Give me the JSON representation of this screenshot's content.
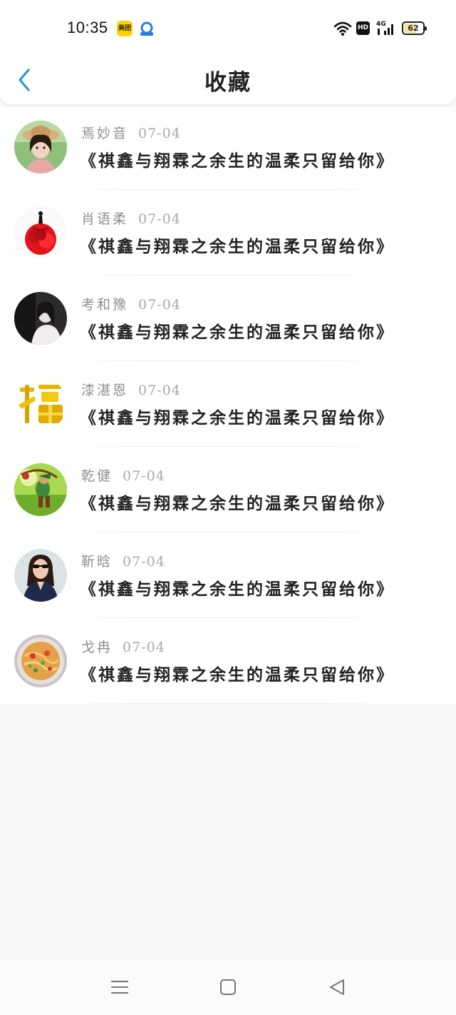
{
  "status_bar": {
    "time": "10:35",
    "meituan_label": "美团",
    "hd_label": "HD",
    "network_label": "4G",
    "battery_level": "62",
    "icons": [
      "meituan-app-icon",
      "blue-app-icon",
      "wifi-icon",
      "hd-icon",
      "signal-icon",
      "battery-icon"
    ]
  },
  "header": {
    "title": "收藏",
    "back_icon": "chevron-left-icon",
    "accent_color": "#2a95e8"
  },
  "favorites": [
    {
      "name": "焉妙音",
      "date": "07-04",
      "title": "《祺鑫与翔霖之余生的温柔只留给你》",
      "avatar": "girl-with-hat"
    },
    {
      "name": "肖语柔",
      "date": "07-04",
      "title": "《祺鑫与翔霖之余生的温柔只留给你》",
      "avatar": "red-rose-dress"
    },
    {
      "name": "考和豫",
      "date": "07-04",
      "title": "《祺鑫与翔霖之余生的温柔只留给你》",
      "avatar": "girl-dark-photo"
    },
    {
      "name": "漆湛恩",
      "date": "07-04",
      "title": "《祺鑫与翔霖之余生的温柔只留给你》",
      "avatar": "golden-fu-character"
    },
    {
      "name": "乾健",
      "date": "07-04",
      "title": "《祺鑫与翔霖之余生的温柔只留给你》",
      "avatar": "game-archer"
    },
    {
      "name": "靳晗",
      "date": "07-04",
      "title": "《祺鑫与翔霖之余生的温柔只留给你》",
      "avatar": "woman-sunglasses"
    },
    {
      "name": "戈冉",
      "date": "07-04",
      "title": "《祺鑫与翔霖之余生的温柔只留给你》",
      "avatar": "noodle-dish"
    }
  ],
  "bottom_nav": {
    "icons": [
      "menu-icon",
      "home-square-icon",
      "back-triangle-icon"
    ]
  }
}
